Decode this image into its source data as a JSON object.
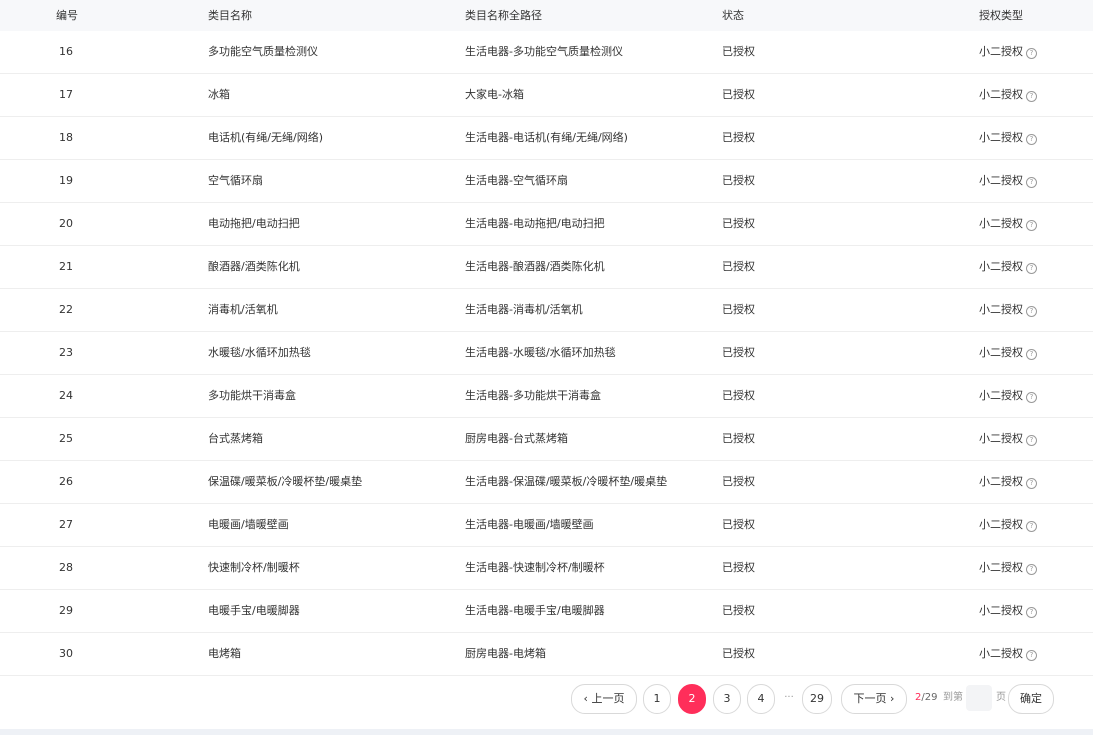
{
  "table": {
    "headers": {
      "id": "编号",
      "name": "类目名称",
      "path": "类目名称全路径",
      "status": "状态",
      "type": "授权类型"
    },
    "rows": [
      {
        "id": "16",
        "name": "多功能空气质量检测仪",
        "path": "生活电器-多功能空气质量检测仪",
        "status": "已授权",
        "type": "小二授权"
      },
      {
        "id": "17",
        "name": "冰箱",
        "path": "大家电-冰箱",
        "status": "已授权",
        "type": "小二授权"
      },
      {
        "id": "18",
        "name": "电话机(有绳/无绳/网络)",
        "path": "生活电器-电话机(有绳/无绳/网络)",
        "status": "已授权",
        "type": "小二授权"
      },
      {
        "id": "19",
        "name": "空气循环扇",
        "path": "生活电器-空气循环扇",
        "status": "已授权",
        "type": "小二授权"
      },
      {
        "id": "20",
        "name": "电动拖把/电动扫把",
        "path": "生活电器-电动拖把/电动扫把",
        "status": "已授权",
        "type": "小二授权"
      },
      {
        "id": "21",
        "name": "酿酒器/酒类陈化机",
        "path": "生活电器-酿酒器/酒类陈化机",
        "status": "已授权",
        "type": "小二授权"
      },
      {
        "id": "22",
        "name": "消毒机/活氧机",
        "path": "生活电器-消毒机/活氧机",
        "status": "已授权",
        "type": "小二授权"
      },
      {
        "id": "23",
        "name": "水暖毯/水循环加热毯",
        "path": "生活电器-水暖毯/水循环加热毯",
        "status": "已授权",
        "type": "小二授权"
      },
      {
        "id": "24",
        "name": "多功能烘干消毒盒",
        "path": "生活电器-多功能烘干消毒盒",
        "status": "已授权",
        "type": "小二授权"
      },
      {
        "id": "25",
        "name": "台式蒸烤箱",
        "path": "厨房电器-台式蒸烤箱",
        "status": "已授权",
        "type": "小二授权"
      },
      {
        "id": "26",
        "name": "保温碟/暖菜板/冷暖杯垫/暖桌垫",
        "path": "生活电器-保温碟/暖菜板/冷暖杯垫/暖桌垫",
        "status": "已授权",
        "type": "小二授权"
      },
      {
        "id": "27",
        "name": "电暖画/墙暖壁画",
        "path": "生活电器-电暖画/墙暖壁画",
        "status": "已授权",
        "type": "小二授权"
      },
      {
        "id": "28",
        "name": "快速制冷杯/制暖杯",
        "path": "生活电器-快速制冷杯/制暖杯",
        "status": "已授权",
        "type": "小二授权"
      },
      {
        "id": "29",
        "name": "电暖手宝/电暖脚器",
        "path": "生活电器-电暖手宝/电暖脚器",
        "status": "已授权",
        "type": "小二授权"
      },
      {
        "id": "30",
        "name": "电烤箱",
        "path": "厨房电器-电烤箱",
        "status": "已授权",
        "type": "小二授权"
      }
    ]
  },
  "icons": {
    "help": "question-circle-icon"
  },
  "pagination": {
    "prev": "‹ 上一页",
    "next": "下一页 ›",
    "pages": [
      "1",
      "2",
      "3",
      "4",
      "29"
    ],
    "ellipsis": "···",
    "current": "2",
    "total": "29",
    "info_sep": "/",
    "goto_prefix": "到第",
    "goto_suffix": "页",
    "goto_value": "",
    "confirm": "确定"
  },
  "colors": {
    "accent": "#ff2e5a",
    "header_bg": "#f7f8fa",
    "border": "#eeeeee"
  }
}
